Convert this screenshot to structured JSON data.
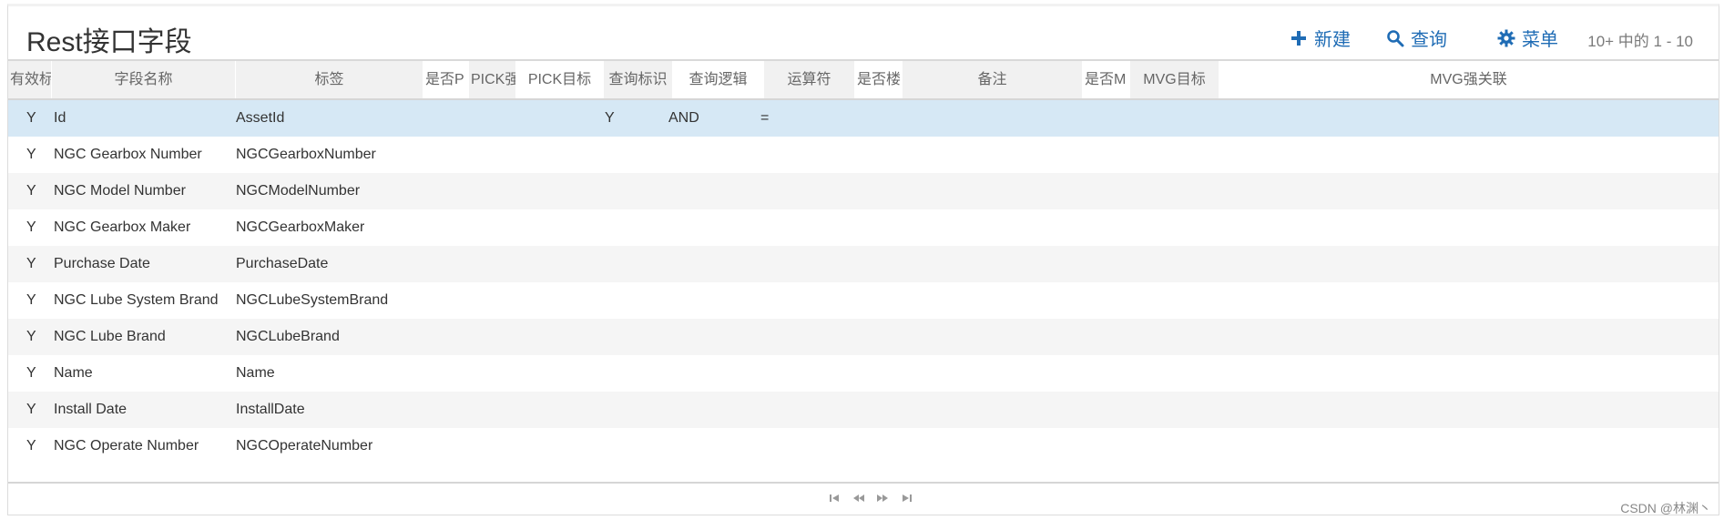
{
  "applet": {
    "title": "Rest接口字段",
    "new_label": "新建",
    "query_label": "查询",
    "menu_label": "菜单",
    "record_count": "10+ 中的 1 - 10"
  },
  "columns": [
    "有效标",
    "字段名称",
    "标签",
    "是否P",
    "PICK强",
    "PICK目标",
    "查询标识",
    "查询逻辑",
    "运算符",
    "是否楼",
    "备注",
    "是否M",
    "MVG目标",
    "MVG强关联"
  ],
  "rows": [
    {
      "active": "Y",
      "name": "Id",
      "label": "AssetId",
      "query_flag": "Y",
      "query_logic": "AND",
      "operator": "="
    },
    {
      "active": "Y",
      "name": "NGC Gearbox Number",
      "label": "NGCGearboxNumber",
      "query_flag": "",
      "query_logic": "",
      "operator": ""
    },
    {
      "active": "Y",
      "name": "NGC Model Number",
      "label": "NGCModelNumber",
      "query_flag": "",
      "query_logic": "",
      "operator": ""
    },
    {
      "active": "Y",
      "name": "NGC Gearbox Maker",
      "label": "NGCGearboxMaker",
      "query_flag": "",
      "query_logic": "",
      "operator": ""
    },
    {
      "active": "Y",
      "name": "Purchase Date",
      "label": "PurchaseDate",
      "query_flag": "",
      "query_logic": "",
      "operator": ""
    },
    {
      "active": "Y",
      "name": "NGC Lube System Brand",
      "label": "NGCLubeSystemBrand",
      "query_flag": "",
      "query_logic": "",
      "operator": ""
    },
    {
      "active": "Y",
      "name": "NGC Lube Brand",
      "label": "NGCLubeBrand",
      "query_flag": "",
      "query_logic": "",
      "operator": ""
    },
    {
      "active": "Y",
      "name": "Name",
      "label": "Name",
      "query_flag": "",
      "query_logic": "",
      "operator": ""
    },
    {
      "active": "Y",
      "name": "Install Date",
      "label": "InstallDate",
      "query_flag": "",
      "query_logic": "",
      "operator": ""
    },
    {
      "active": "Y",
      "name": "NGC Operate Number",
      "label": "NGCOperateNumber",
      "query_flag": "",
      "query_logic": "",
      "operator": ""
    }
  ],
  "selected_row": 0,
  "watermark": "CSDN @林渊丶",
  "colors": {
    "accent": "#1f6cb5",
    "selected_row": "#d6e8f5",
    "alt_row": "#f5f5f5"
  },
  "icons": {
    "new": "plus-icon",
    "query": "search-icon",
    "menu": "gear-icon",
    "pager": [
      "first-page-icon",
      "prev-page-icon",
      "next-page-icon",
      "last-page-icon"
    ]
  }
}
